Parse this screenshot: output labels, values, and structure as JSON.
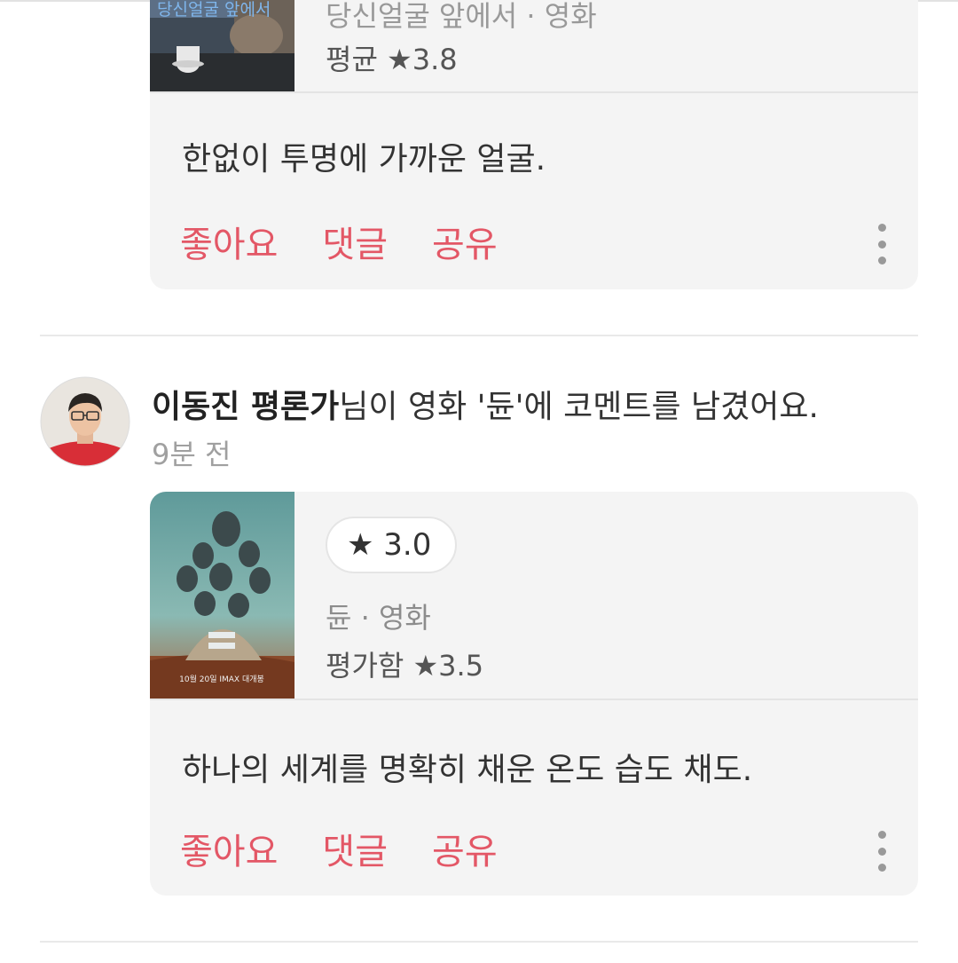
{
  "feed": {
    "items": [
      {
        "poster_caption": "당신얼굴 앞에서",
        "movie_meta": "당신얼굴 앞에서 · 영화",
        "avg_rating_text": "평균 ★3.8",
        "comment": "한없이 투명에 가까운 얼굴.",
        "actions": {
          "like": "좋아요",
          "comment": "댓글",
          "share": "공유"
        }
      },
      {
        "author": "이동진 평론가",
        "headline_rest": "님이 영화 '듄'에 코멘트를 남겼어요.",
        "time": "9분 전",
        "rating_badge": "★ 3.0",
        "movie_meta": "듄 · 영화",
        "user_rating_text": "평가함 ★3.5",
        "poster_bottom_text": "10월 20일 IMAX 대개봉",
        "comment": "하나의 세계를 명확히 채운 온도 습도 채도.",
        "actions": {
          "like": "좋아요",
          "comment": "댓글",
          "share": "공유"
        }
      }
    ]
  },
  "colors": {
    "accent": "#e35766",
    "card_bg": "#f4f4f4",
    "muted": "#8c8c8c"
  },
  "icons": {
    "more": "more-vertical-icon",
    "star": "star-icon",
    "avatar": "avatar"
  }
}
